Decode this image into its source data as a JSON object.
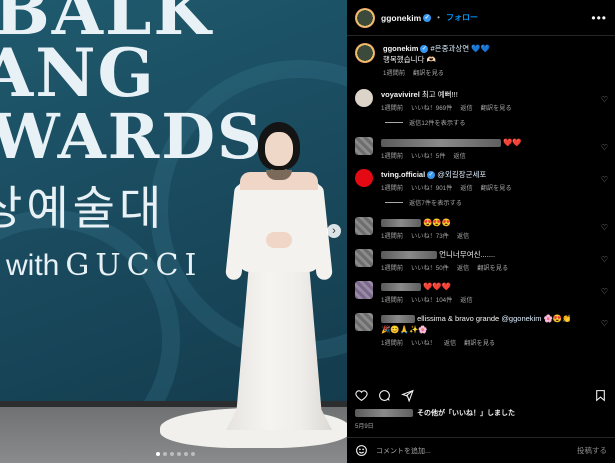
{
  "photo": {
    "backdrop_lines": [
      "BALK",
      "ANG",
      "WARDS"
    ],
    "backdrop_korean": "상예술대",
    "backdrop_with": "with",
    "backdrop_brand": "GUCCI",
    "next_icon": "chevron-right-icon",
    "page_dots": 6,
    "active_dot": 0
  },
  "header": {
    "username": "ggonekim",
    "follow_label": "フォロー",
    "separator": "•",
    "more_icon": "ellipsis-icon"
  },
  "caption": {
    "username": "ggonekim",
    "hashtag": "#은중과상연",
    "emoji": "💙💙",
    "text": "행복했습니다 🫶🏻",
    "time": "1週間前",
    "translate": "翻訳を見る"
  },
  "comments": [
    {
      "user": "voyavivirel",
      "text": "최고 예뻐!!!",
      "time": "1週間前",
      "likes": "いいね！969件",
      "reply": "返信",
      "translate": "翻訳を見る",
      "replies": "返信12件を表示する"
    },
    {
      "user": "",
      "text": "❤️❤️",
      "time": "1週間前",
      "likes": "いいね！5件",
      "reply": "返信",
      "translate": ""
    },
    {
      "user": "tving.official",
      "text": "@외길장군세포",
      "time": "1週間前",
      "likes": "いいね！901件",
      "reply": "返信",
      "translate": "翻訳を見る",
      "replies": "返信7件を表示する"
    },
    {
      "user": "",
      "text": "😍😍😍",
      "time": "1週間前",
      "likes": "いいね！73件",
      "reply": "返信",
      "translate": ""
    },
    {
      "user": "",
      "text": "언니너무여신.......",
      "time": "1週間前",
      "likes": "いいね！50件",
      "reply": "返信",
      "translate": "翻訳を見る"
    },
    {
      "user": "",
      "text": "❤️❤️❤️",
      "time": "1週間前",
      "likes": "いいね！104件",
      "reply": "返信",
      "translate": ""
    },
    {
      "user": "",
      "text_prefix": "ellissima & bravo grande",
      "mention": "@ggonekim",
      "text_suffix": "🌸😍👏",
      "text_line2": "🎉😊🙏✨🌸",
      "time": "1週間前",
      "likes": "いいね！",
      "reply": "返信",
      "translate": "翻訳を見る"
    }
  ],
  "actions": {
    "like_icon": "heart-icon",
    "comment_icon": "comment-icon",
    "share_icon": "send-icon",
    "save_icon": "bookmark-icon"
  },
  "likes_text": "その他が「いいね！」しました",
  "date": "5月9日",
  "add_comment": {
    "emoji_icon": "emoji-icon",
    "placeholder": "コメントを追加...",
    "post_label": "投稿する"
  }
}
